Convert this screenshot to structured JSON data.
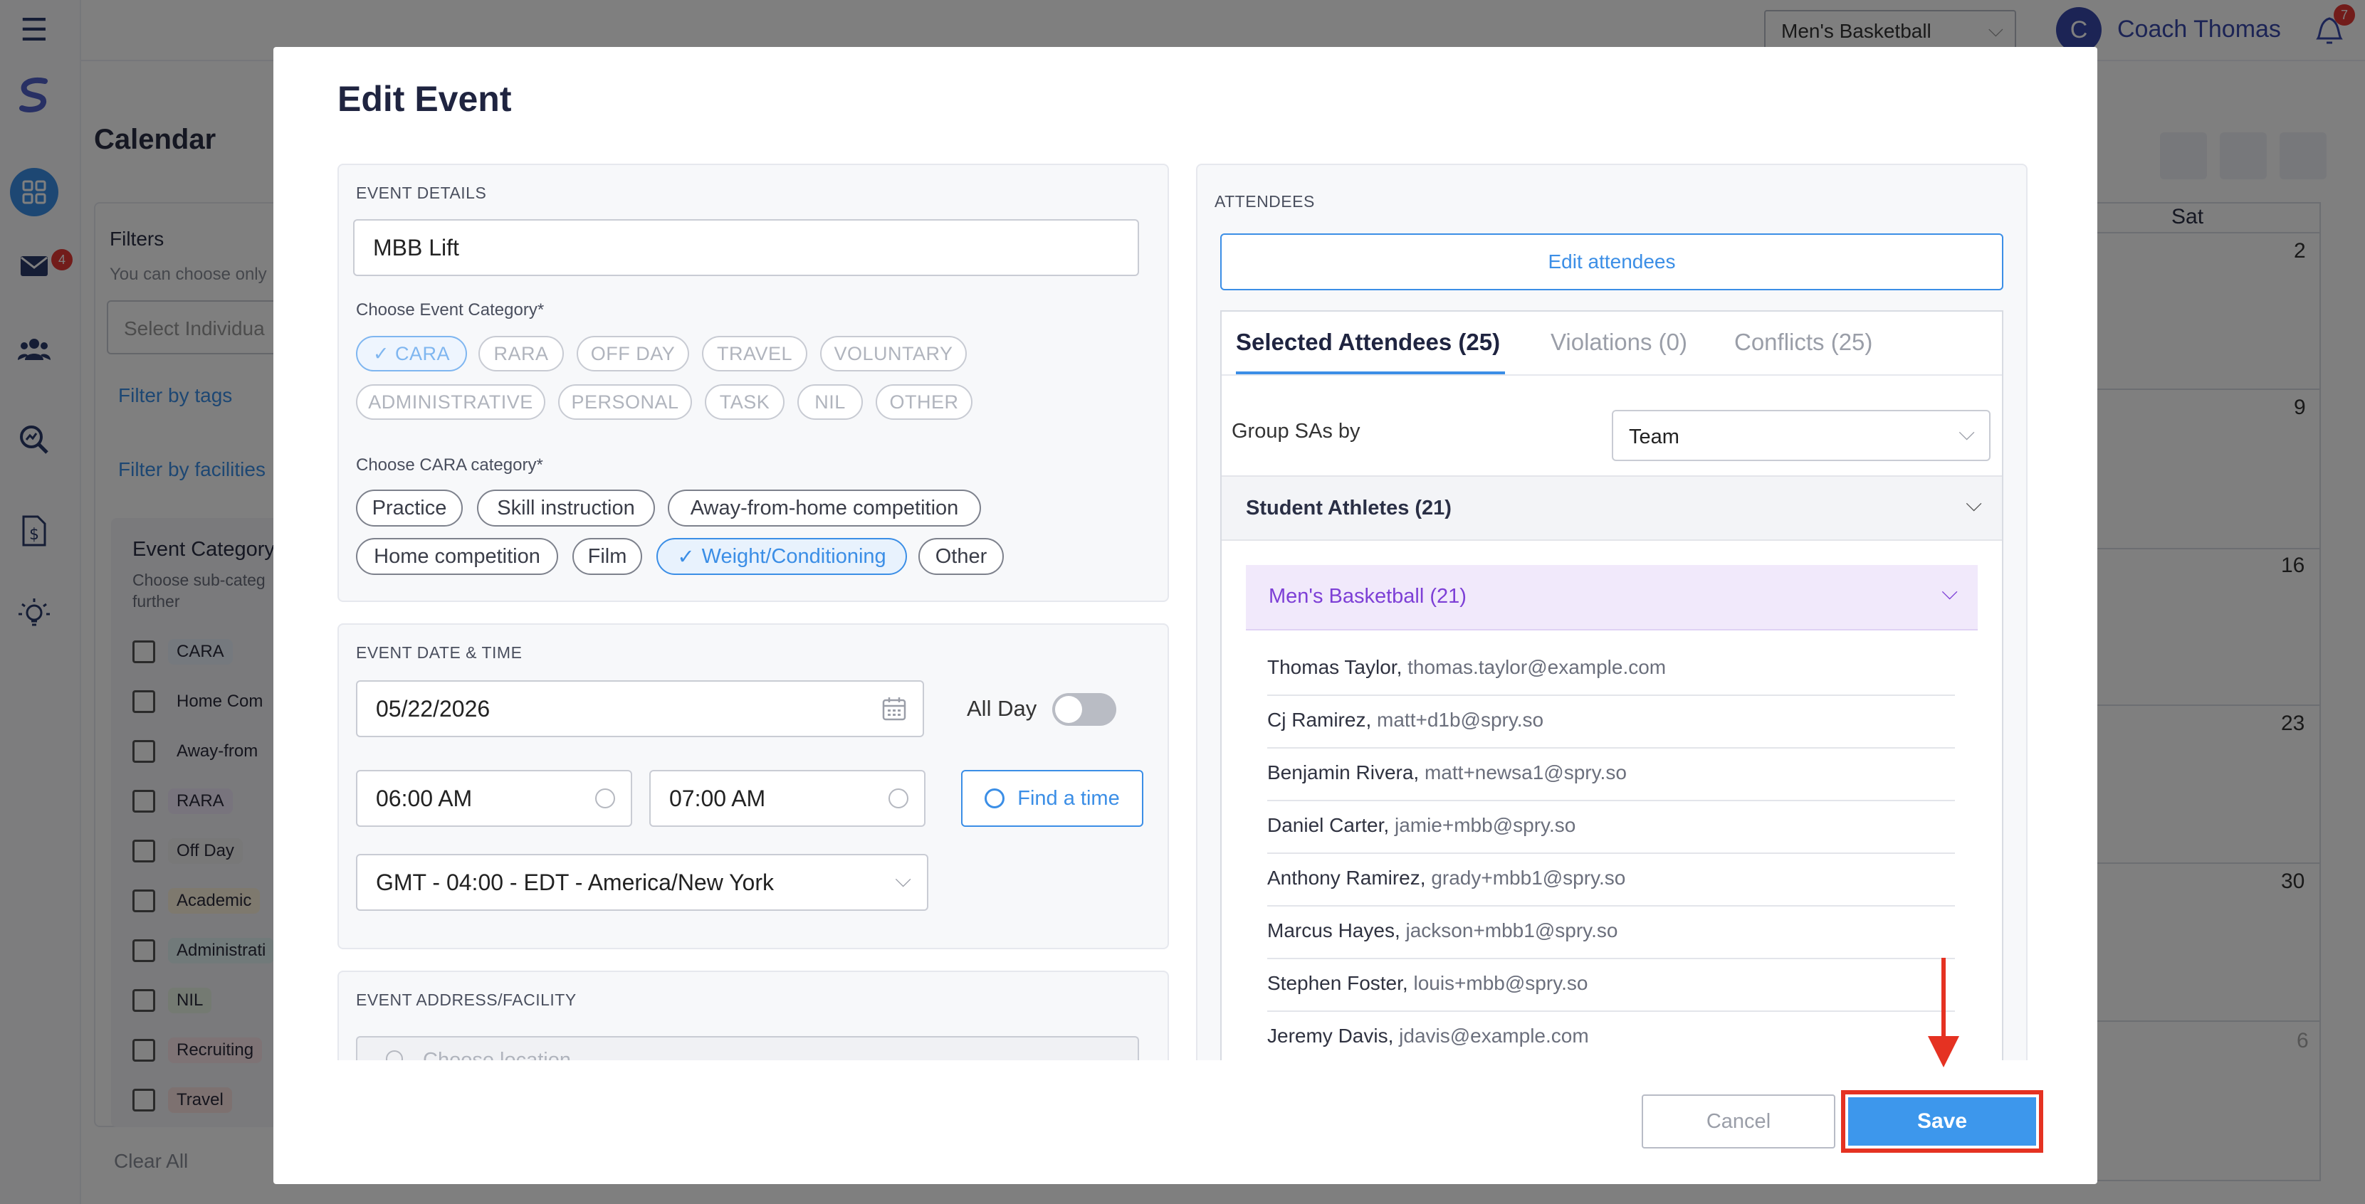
{
  "header": {
    "team_select": "Men's Basketball",
    "user_initial": "C",
    "user_name": "Coach Thomas",
    "notification_count": "7"
  },
  "sidebar": {
    "messages_badge": "4"
  },
  "page": {
    "title": "Calendar"
  },
  "filters": {
    "title": "Filters",
    "hint": "You can choose only",
    "select_placeholder": "Select Individua",
    "filter_tags": "Filter by tags",
    "filter_facilities": "Filter by facilities",
    "event_category_title": "Event Category",
    "event_category_hint": "Choose sub-categ further",
    "categories": [
      "CARA",
      "Home Com",
      "Away-from",
      "RARA",
      "Off Day",
      "Academic",
      "Administrati",
      "NIL",
      "Recruiting",
      "Travel"
    ],
    "clear_all": "Clear All"
  },
  "calendar": {
    "sat_header": "Sat",
    "days": [
      "2",
      "9",
      "16",
      "23",
      "30",
      "6"
    ]
  },
  "modal": {
    "title": "Edit Event",
    "event_details": {
      "section_label": "EVENT DETAILS",
      "name_value": "MBB Lift",
      "category_label": "Choose Event Category*",
      "categories": [
        "CARA",
        "RARA",
        "OFF DAY",
        "TRAVEL",
        "VOLUNTARY",
        "ADMINISTRATIVE",
        "PERSONAL",
        "TASK",
        "NIL",
        "OTHER"
      ],
      "selected_category": "CARA",
      "cara_label": "Choose CARA category*",
      "cara_categories": [
        "Practice",
        "Skill instruction",
        "Away-from-home competition",
        "Home competition",
        "Film",
        "Weight/Conditioning",
        "Other"
      ],
      "selected_cara": "Weight/Conditioning"
    },
    "date_time": {
      "section_label": "EVENT DATE & TIME",
      "date": "05/22/2026",
      "all_day_label": "All Day",
      "all_day": false,
      "start_time": "06:00 AM",
      "end_time": "07:00 AM",
      "find_time_label": "Find a time",
      "timezone": "GMT - 04:00 - EDT - America/New York"
    },
    "address": {
      "section_label": "EVENT ADDRESS/FACILITY",
      "placeholder": "Choose location"
    },
    "attendees": {
      "section_label": "ATTENDEES",
      "edit_button": "Edit attendees",
      "tabs": [
        "Selected Attendees (25)",
        "Violations (0)",
        "Conflicts (25)"
      ],
      "group_by_label": "Group SAs by",
      "group_by_value": "Team",
      "student_group": "Student Athletes (21)",
      "team_group": "Men's Basketball (21)",
      "list": [
        {
          "name": "Thomas Taylor,",
          "email": "thomas.taylor@example.com"
        },
        {
          "name": "Cj Ramirez,",
          "email": "matt+d1b@spry.so"
        },
        {
          "name": "Benjamin Rivera,",
          "email": "matt+newsa1@spry.so"
        },
        {
          "name": "Daniel Carter,",
          "email": "jamie+mbb@spry.so"
        },
        {
          "name": "Anthony Ramirez,",
          "email": "grady+mbb1@spry.so"
        },
        {
          "name": "Marcus Hayes,",
          "email": "jackson+mbb1@spry.so"
        },
        {
          "name": "Stephen Foster,",
          "email": "louis+mbb@spry.so"
        },
        {
          "name": "Jeremy Davis,",
          "email": "jdavis@example.com"
        }
      ]
    },
    "buttons": {
      "cancel": "Cancel",
      "save": "Save"
    }
  },
  "colors": {
    "primary": "#3b8ee6",
    "save_button": "#3d97ec",
    "highlight_box": "#e53222",
    "team_group_bg": "#f1e9fb",
    "team_group_text": "#7d3fd6"
  }
}
